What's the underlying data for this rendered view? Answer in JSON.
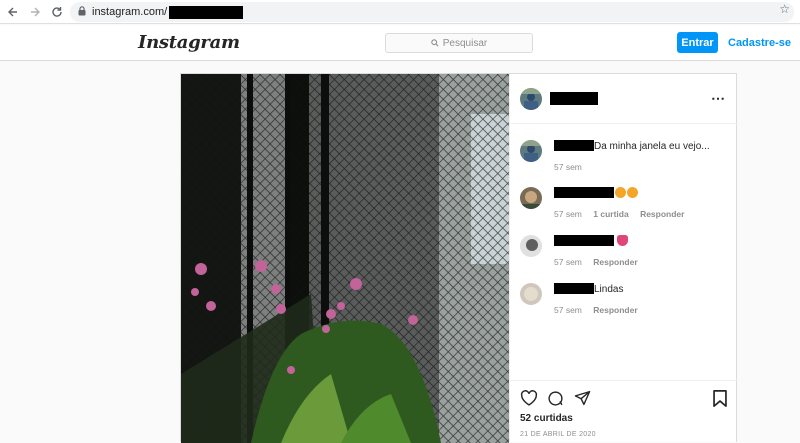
{
  "browser": {
    "url": "instagram.com/",
    "icons": [
      "back-icon",
      "forward-icon",
      "reload-icon",
      "lock-icon",
      "star-icon"
    ]
  },
  "header": {
    "logo": "Instagram",
    "search_placeholder": "Pesquisar",
    "login_label": "Entrar",
    "signup_label": "Cadastre-se",
    "accent": "#0095f6"
  },
  "post": {
    "caption": {
      "text": "Da minha janela eu vejo...",
      "time": "57 sem"
    },
    "comments": [
      {
        "text": "",
        "time": "57 sem",
        "likes": "1 curtida",
        "reply": "Responder"
      },
      {
        "text": "",
        "time": "57 sem",
        "reply": "Responder"
      },
      {
        "text": "Lindas",
        "time": "57 sem",
        "reply": "Responder"
      }
    ],
    "likes": "52 curtidas",
    "date": "21 DE ABRIL DE 2020",
    "more_icon": "⋯"
  }
}
